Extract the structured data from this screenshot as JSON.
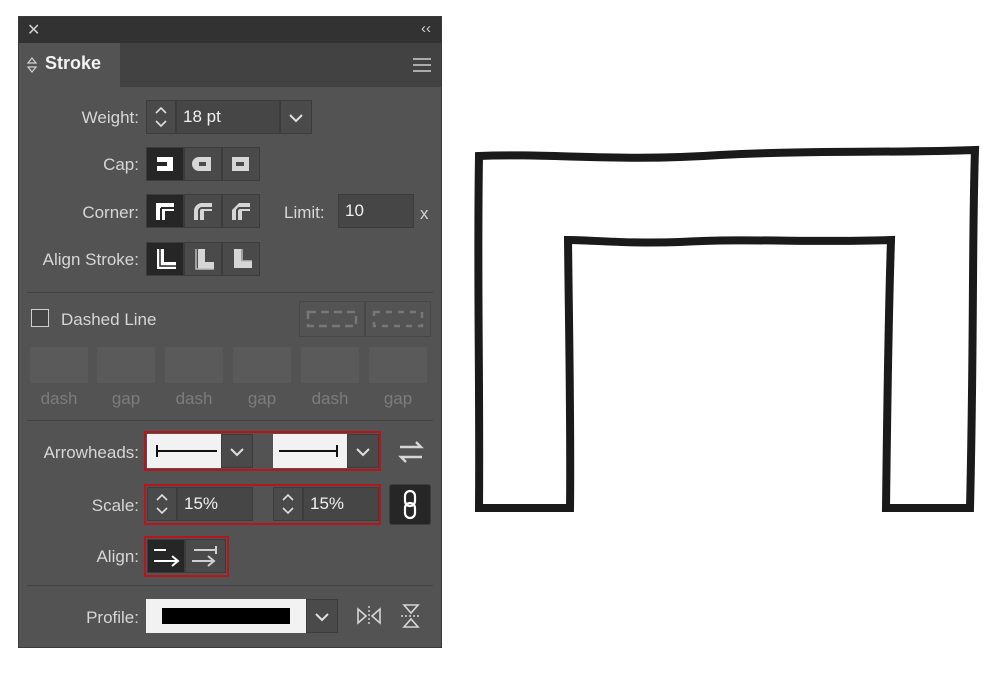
{
  "panel": {
    "close_glyph": "✕",
    "collapse_glyph": "‹‹",
    "tab_title": "Stroke",
    "menu_icon": "hamburger-icon"
  },
  "weight": {
    "label": "Weight:",
    "value": "18 pt"
  },
  "cap": {
    "label": "Cap:",
    "selected": "butt"
  },
  "corner": {
    "label": "Corner:",
    "selected": "miter",
    "limit_label": "Limit:",
    "limit_value": "10",
    "limit_unit": "x"
  },
  "align_stroke": {
    "label": "Align Stroke:",
    "selected": "center"
  },
  "dashed": {
    "label": "Dashed Line",
    "checked": false,
    "fields": [
      "dash",
      "gap",
      "dash",
      "gap",
      "dash",
      "gap"
    ]
  },
  "arrowheads": {
    "label": "Arrowheads:"
  },
  "scale": {
    "label": "Scale:",
    "start": "15%",
    "end": "15%"
  },
  "align": {
    "label": "Align:"
  },
  "profile": {
    "label": "Profile:"
  },
  "colors": {
    "panel": "#535353",
    "highlight": "#b5151b",
    "selected": "#262626"
  }
}
